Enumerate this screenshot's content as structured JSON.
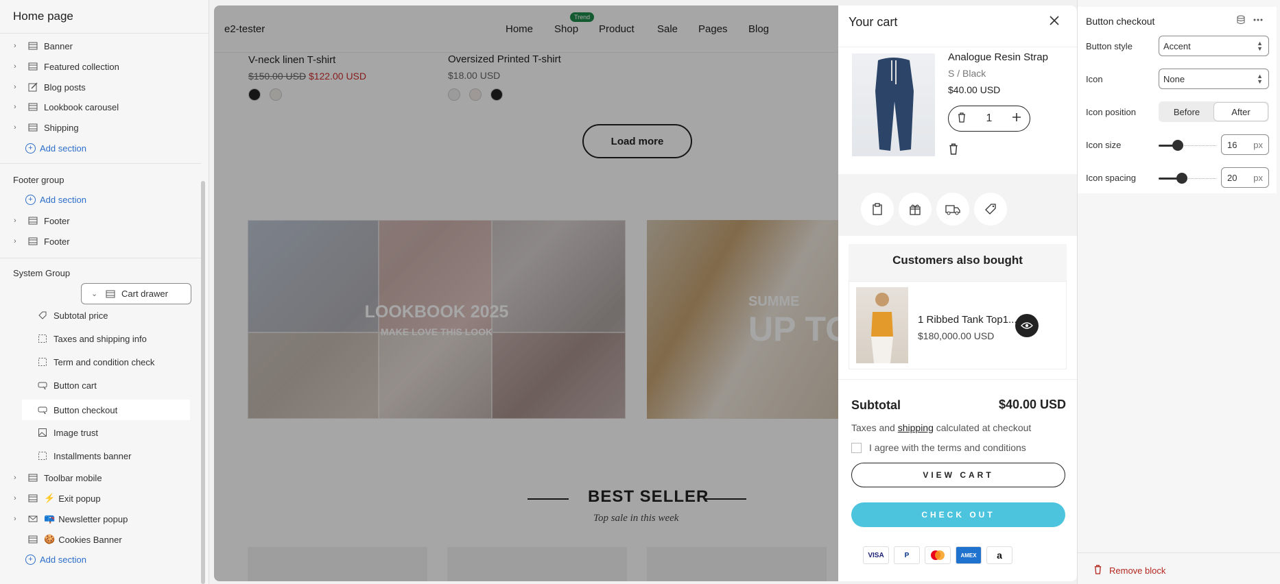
{
  "sidebar": {
    "title": "Home page",
    "template_items": [
      "Banner",
      "Featured collection",
      "Blog posts",
      "Lookbook carousel",
      "Shipping"
    ],
    "add_section": "Add section",
    "footer_group": "Footer group",
    "footer_items": [
      "Footer",
      "Footer"
    ],
    "system_group": "System Group",
    "cart_drawer": "Cart drawer",
    "cart_blocks": [
      "Subtotal price",
      "Taxes and shipping info",
      "Term and condition check",
      "Button cart",
      "Button checkout",
      "Image trust",
      "Installments banner"
    ],
    "system_items": [
      {
        "emoji": "",
        "label": "Toolbar mobile"
      },
      {
        "emoji": "⚡",
        "label": "Exit popup"
      },
      {
        "emoji": "📪",
        "label": "Newsletter popup"
      },
      {
        "emoji": "🍪",
        "label": "Cookies Banner"
      }
    ]
  },
  "store": {
    "logo": "e2-tester",
    "menu": [
      "Home",
      "Shop",
      "Product",
      "Sale",
      "Pages",
      "Blog"
    ],
    "trend_badge": "Trend",
    "products": [
      {
        "name": "V-neck linen T-shirt",
        "old_price": "$150.00 USD",
        "price": "$122.00 USD"
      },
      {
        "name": "Oversized Printed T-shirt",
        "price": "$18.00 USD"
      }
    ],
    "load_more": "Load more",
    "lookbook_title": "LOOKBOOK 2025",
    "lookbook_sub": "MAKE LOVE THIS LOOK",
    "summer_t1": "SUMME",
    "summer_t2": "UP TO",
    "best_seller": "BEST SELLER",
    "top_sale": "Top sale in this week"
  },
  "cart": {
    "title": "Your cart",
    "item": {
      "name": "Analogue Resin Strap",
      "variant": "S / Black",
      "price": "$40.00 USD",
      "qty": "1"
    },
    "also_bought_title": "Customers also bought",
    "also_bought_item": {
      "name": "1 Ribbed Tank Top1...",
      "price": "$180,000.00 USD"
    },
    "subtotal_label": "Subtotal",
    "subtotal_value": "$40.00 USD",
    "tax_before": "Taxes and ",
    "tax_link": "shipping",
    "tax_after": " calculated at checkout",
    "agree": "I agree with the terms and conditions",
    "view_cart": "VIEW CART",
    "checkout": "CHECK OUT",
    "payments": [
      "VISA",
      "P",
      "MC",
      "AMEX",
      "a"
    ],
    "colors": {
      "checkout": "#4dc4dd"
    }
  },
  "panel": {
    "title": "Button checkout",
    "button_style_label": "Button style",
    "button_style_value": "Accent",
    "icon_label": "Icon",
    "icon_value": "None",
    "icon_position_label": "Icon position",
    "icon_position_options": [
      "Before",
      "After"
    ],
    "icon_position_selected": "After",
    "icon_size_label": "Icon size",
    "icon_size_value": "16",
    "icon_spacing_label": "Icon spacing",
    "icon_spacing_value": "20",
    "unit": "px",
    "remove_block": "Remove block"
  }
}
